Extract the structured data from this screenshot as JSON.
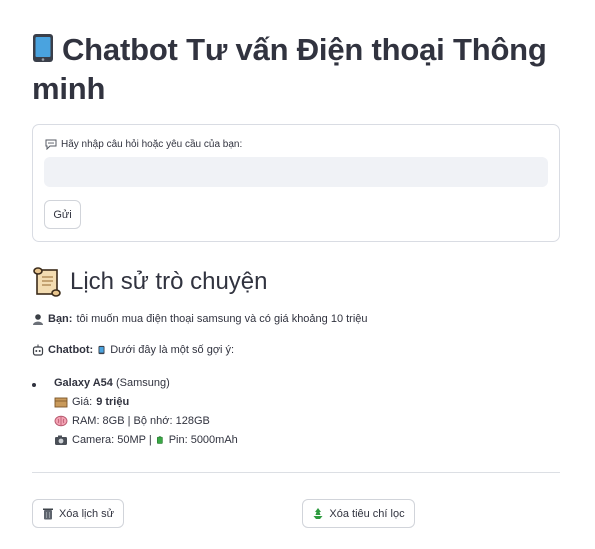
{
  "header": {
    "title": "Chatbot Tư vấn Điện thoại Thông minh",
    "icon": "mobile-phone-icon"
  },
  "form": {
    "label": "Hãy nhập câu hỏi hoặc yêu cầu của bạn:",
    "label_icon": "speech-bubble-icon",
    "input_value": "",
    "input_placeholder": "",
    "send_label": "Gửi"
  },
  "history": {
    "title": "Lịch sử trò chuyện",
    "title_icon": "scroll-icon",
    "user_label": "Bạn:",
    "user_message": "tôi muốn mua điện thoại samsung và có giá khoảng 10 triệu",
    "bot_label": "Chatbot:",
    "bot_intro": "Dưới đây là một số gợi ý:",
    "product": {
      "name": "Galaxy A54",
      "brand": "(Samsung)",
      "price_label": "Giá:",
      "price_value": "9 triệu",
      "memory": "RAM: 8GB | Bộ nhớ: 128GB",
      "camera": "Camera: 50MP |",
      "battery": "Pin: 5000mAh"
    }
  },
  "actions": {
    "clear_history": "Xóa lịch sử",
    "clear_filters": "Xóa tiêu chí lọc"
  },
  "colors": {
    "text": "#31333f",
    "input_bg": "#f0f2f6",
    "border": "#d9dce3"
  }
}
